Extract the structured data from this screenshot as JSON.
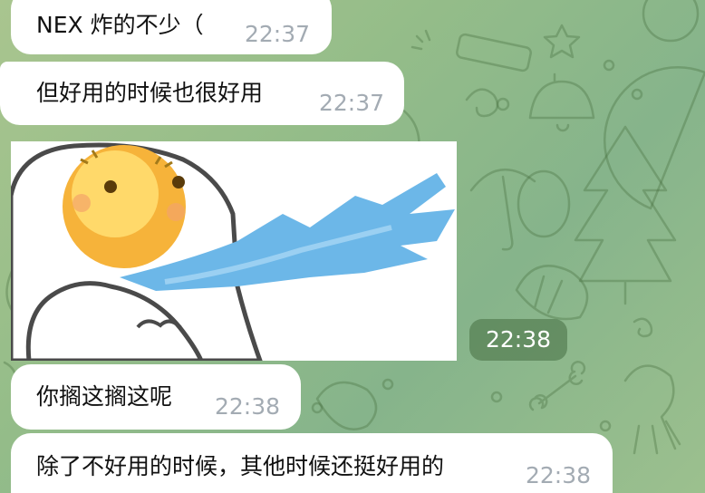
{
  "messages": [
    {
      "text": "NEX 炸的不少（",
      "time": "22:37"
    },
    {
      "text": "但好用的时候也很好用",
      "time": "22:37"
    },
    {
      "type": "photo",
      "sticker": "emoji-face-blowing-blue-stream",
      "time": "22:38"
    },
    {
      "text": "你搁这搁这呢",
      "time": "22:38"
    },
    {
      "text": "除了不好用的时候，其他时候还挺好用的",
      "time": "22:38"
    }
  ],
  "colors": {
    "bubble": "#ffffff",
    "time_text": "#a3abb3",
    "background": "#95bd89",
    "photo_time_badge": "#4e7a4a"
  }
}
